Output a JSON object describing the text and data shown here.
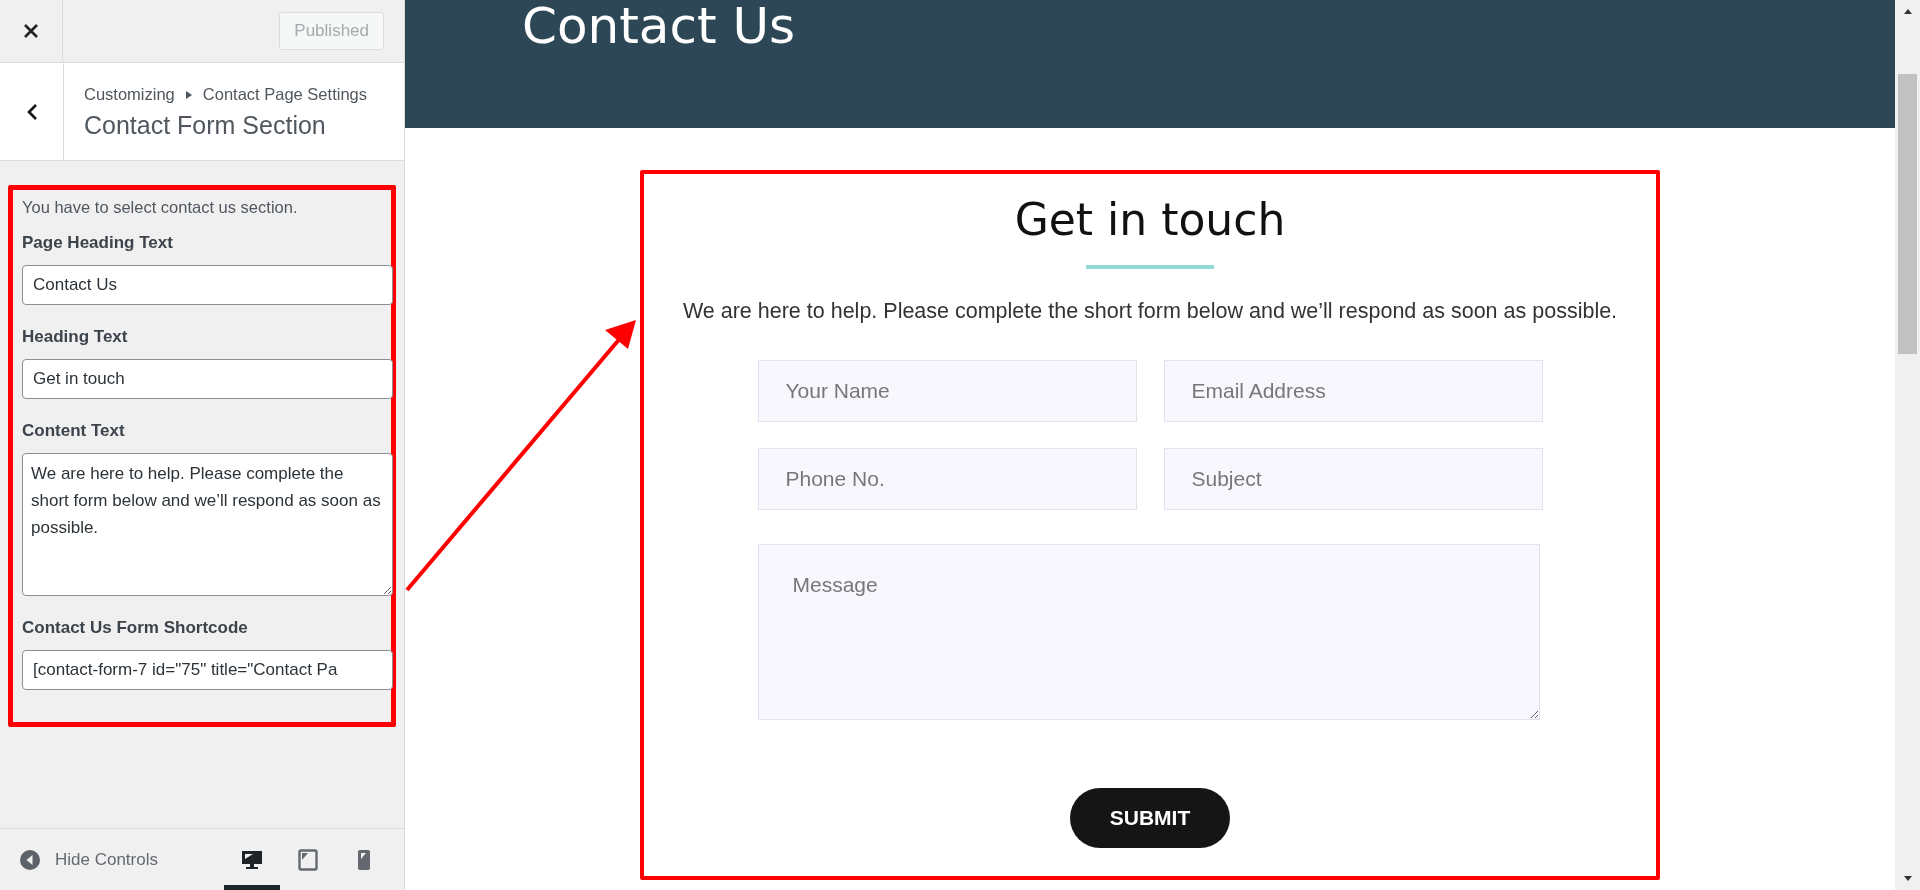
{
  "customizer": {
    "publish_button": {
      "label": "Published",
      "disabled": true
    },
    "breadcrumb": [
      "Customizing",
      "Contact Page Settings"
    ],
    "section_title": "Contact Form Section",
    "description": "You have to select contact us section.",
    "controls": [
      {
        "kind": "text",
        "label": "Page Heading Text",
        "value": "Contact Us"
      },
      {
        "kind": "text",
        "label": "Heading Text",
        "value": "Get in touch"
      },
      {
        "kind": "textarea",
        "label": "Content Text",
        "value": "We are here to help. Please complete the short form below and we’ll respond as soon as possible."
      },
      {
        "kind": "text",
        "label": "Contact Us Form Shortcode",
        "value": "[contact-form-7 id=\"75\" title=\"Contact Pa"
      }
    ],
    "footer": {
      "hide_label": "Hide Controls",
      "devices": [
        {
          "kind": "desktop",
          "selected": true
        },
        {
          "kind": "tablet",
          "selected": false
        },
        {
          "kind": "mobile",
          "selected": false
        }
      ]
    }
  },
  "preview": {
    "page_heading": "Contact Us",
    "heading": "Get in touch",
    "intro": "We are here to help. Please complete the short form below and we’ll respond as soon as possible.",
    "fields": [
      {
        "kind": "input",
        "placeholder": "Your Name"
      },
      {
        "kind": "input",
        "placeholder": "Email Address"
      },
      {
        "kind": "input",
        "placeholder": "Phone No."
      },
      {
        "kind": "input",
        "placeholder": "Subject"
      },
      {
        "kind": "textarea",
        "placeholder": "Message"
      }
    ],
    "submit": "SUBMIT"
  }
}
